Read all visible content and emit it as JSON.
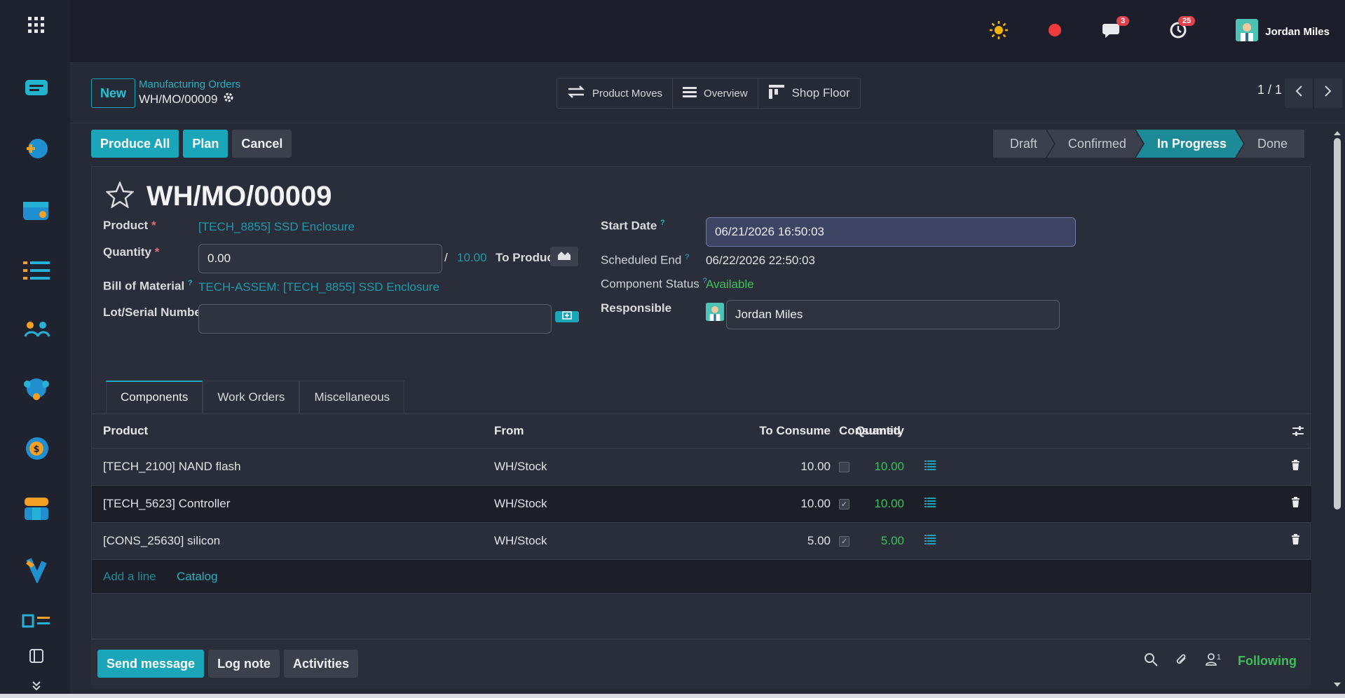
{
  "user": {
    "name": "Jordan Miles"
  },
  "systray": {
    "messages_count": "3",
    "activities_count": "25"
  },
  "control": {
    "new_label": "New",
    "breadcrumb_parent": "Manufacturing Orders",
    "breadcrumb_current": "WH/MO/00009",
    "smart_buttons": [
      "Product Moves",
      "Overview",
      "Shop Floor"
    ],
    "pager": "1 / 1"
  },
  "actions": {
    "produce_all": "Produce All",
    "plan": "Plan",
    "cancel": "Cancel"
  },
  "stages": [
    "Draft",
    "Confirmed",
    "In Progress",
    "Done"
  ],
  "active_stage": "In Progress",
  "form": {
    "title": "WH/MO/00009",
    "product_label": "Product",
    "product_value": "[TECH_8855] SSD Enclosure",
    "quantity_label": "Quantity",
    "quantity_value": "0.00",
    "quantity_sep": "/",
    "quantity_total": "10.00",
    "to_produce_label": "To Produce",
    "bom_label": "Bill of Material",
    "bom_value": "TECH-ASSEM: [TECH_8855] SSD Enclosure",
    "lot_label": "Lot/Serial Number",
    "lot_value": "",
    "start_date_label": "Start Date",
    "start_date_value": "06/21/2026 16:50:03",
    "scheduled_end_label": "Scheduled End",
    "scheduled_end_value": "06/22/2026 22:50:03",
    "component_status_label": "Component Status",
    "component_status_value": "Available",
    "responsible_label": "Responsible",
    "responsible_value": "Jordan Miles",
    "help_mark": "?",
    "required_mark": "*"
  },
  "tabs": [
    "Components",
    "Work Orders",
    "Miscellaneous"
  ],
  "table": {
    "headers": {
      "product": "Product",
      "from": "From",
      "to_consume": "To Consume",
      "quantity": "Quantity",
      "consumed": "Consumed"
    },
    "rows": [
      {
        "product": "[TECH_2100] NAND flash",
        "from": "WH/Stock",
        "to_consume": "10.00",
        "quantity": "10.00",
        "consumed": false
      },
      {
        "product": "[TECH_5623] Controller",
        "from": "WH/Stock",
        "to_consume": "10.00",
        "quantity": "10.00",
        "consumed": true
      },
      {
        "product": "[CONS_25630] silicon",
        "from": "WH/Stock",
        "to_consume": "5.00",
        "quantity": "5.00",
        "consumed": true
      }
    ],
    "add_line": "Add a line",
    "catalog": "Catalog"
  },
  "chatter": {
    "send_message": "Send message",
    "log_note": "Log note",
    "activities": "Activities",
    "followers_count": "1",
    "following": "Following"
  },
  "colors": {
    "accent": "#1aa6b8",
    "green": "#3fbf5c",
    "badge_red": "#e0434d"
  }
}
